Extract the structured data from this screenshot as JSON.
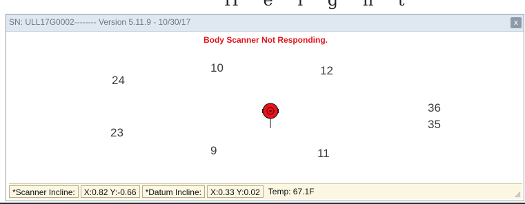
{
  "background_text": "H e i g h t",
  "window": {
    "title": "SN: ULL17G0002-------- Version 5.11.9 - 10/30/17",
    "close_symbol": "x",
    "status_message": "Body Scanner Not Responding."
  },
  "sensors": [
    "10",
    "12",
    "24",
    "36",
    "35",
    "23",
    "9",
    "11"
  ],
  "status_bar": {
    "scanner_incline_label": "*Scanner Incline:",
    "scanner_incline_value": "X:0.82 Y:-0.66",
    "datum_incline_label": "*Datum Incline:",
    "datum_incline_value": "X:0.33 Y:0.02",
    "temp": "Temp: 67.1F"
  },
  "colors": {
    "accent_red": "#e0141b",
    "titlebar": "#dfe7f1",
    "statusbar": "#fbf7e2"
  },
  "icons": {
    "target": "target-marker-icon",
    "close": "close-icon",
    "resize": "resize-grip-icon"
  }
}
